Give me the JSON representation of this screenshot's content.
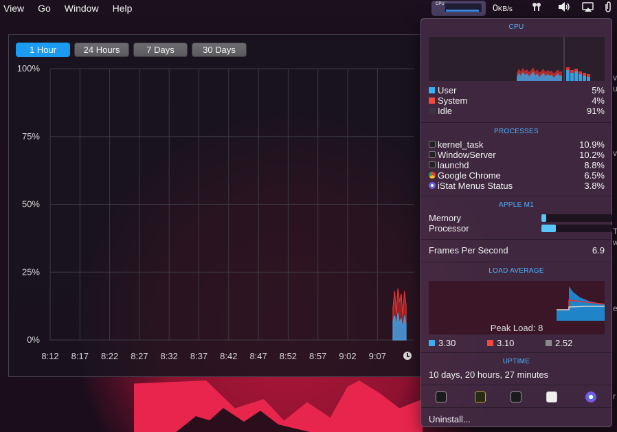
{
  "menubar": {
    "items": [
      "View",
      "Go",
      "Window",
      "Help"
    ],
    "cpu_tag": "CPU",
    "net_value": "0",
    "net_unit": "KB/s"
  },
  "time_ranges": [
    {
      "label": "1 Hour",
      "active": true
    },
    {
      "label": "24 Hours",
      "active": false
    },
    {
      "label": "7 Days",
      "active": false
    },
    {
      "label": "30 Days",
      "active": false
    }
  ],
  "chart_data": {
    "type": "area",
    "y_ticks": [
      "100%",
      "75%",
      "50%",
      "25%",
      "0%"
    ],
    "ylim": [
      0,
      100
    ],
    "x_ticks": [
      "8:12",
      "8:17",
      "8:22",
      "8:27",
      "8:32",
      "8:37",
      "8:42",
      "8:47",
      "8:52",
      "8:57",
      "9:02",
      "9:07"
    ],
    "grid": true,
    "series": [
      {
        "color": "#e8322f",
        "values": [
          12,
          18,
          10,
          19,
          14,
          17,
          9,
          18,
          13
        ]
      },
      {
        "color": "#3a9fe0",
        "values": [
          7,
          9,
          5,
          10,
          6,
          8,
          4,
          9,
          6
        ]
      }
    ]
  },
  "panel": {
    "cpu": {
      "title": "CPU",
      "rows": [
        {
          "label": "User",
          "value": "5%",
          "color": "#38b0f5"
        },
        {
          "label": "System",
          "value": "4%",
          "color": "#f2493d"
        },
        {
          "label": "Idle",
          "value": "91%",
          "color": "#3b3340"
        }
      ]
    },
    "processes": {
      "title": "PROCESSES",
      "rows": [
        {
          "name": "kernel_task",
          "value": "10.9%",
          "icon": "terminal-icon"
        },
        {
          "name": "WindowServer",
          "value": "10.2%",
          "icon": "terminal-icon"
        },
        {
          "name": "launchd",
          "value": "8.8%",
          "icon": "terminal-icon"
        },
        {
          "name": "Google Chrome",
          "value": "6.5%",
          "icon": "chrome-icon"
        },
        {
          "name": "iStat Menus Status",
          "value": "3.8%",
          "icon": "istat-icon"
        }
      ]
    },
    "apple_m1": {
      "title": "APPLE M1",
      "memory_label": "Memory",
      "memory_fraction": 0.07,
      "processor_label": "Processor",
      "processor_fraction": 0.2
    },
    "fps": {
      "label": "Frames Per Second",
      "value": "6.9"
    },
    "load_average": {
      "title": "LOAD AVERAGE",
      "peak": "Peak Load: 8",
      "values": [
        {
          "value": "3.30",
          "color": "#38b0f5"
        },
        {
          "value": "3.10",
          "color": "#f2493d"
        },
        {
          "value": "2.52",
          "color": "#8a8a8a"
        }
      ]
    },
    "uptime": {
      "title": "UPTIME",
      "value": "10 days, 20 hours, 27 minutes"
    },
    "tools": [
      "activity-monitor-icon",
      "console-icon",
      "terminal-icon",
      "system-info-icon",
      "istat-menus-icon"
    ],
    "uninstall": "Uninstall..."
  },
  "edge_fragments": [
    "v",
    "ul",
    "v",
    "T",
    "w",
    "e",
    "r"
  ]
}
